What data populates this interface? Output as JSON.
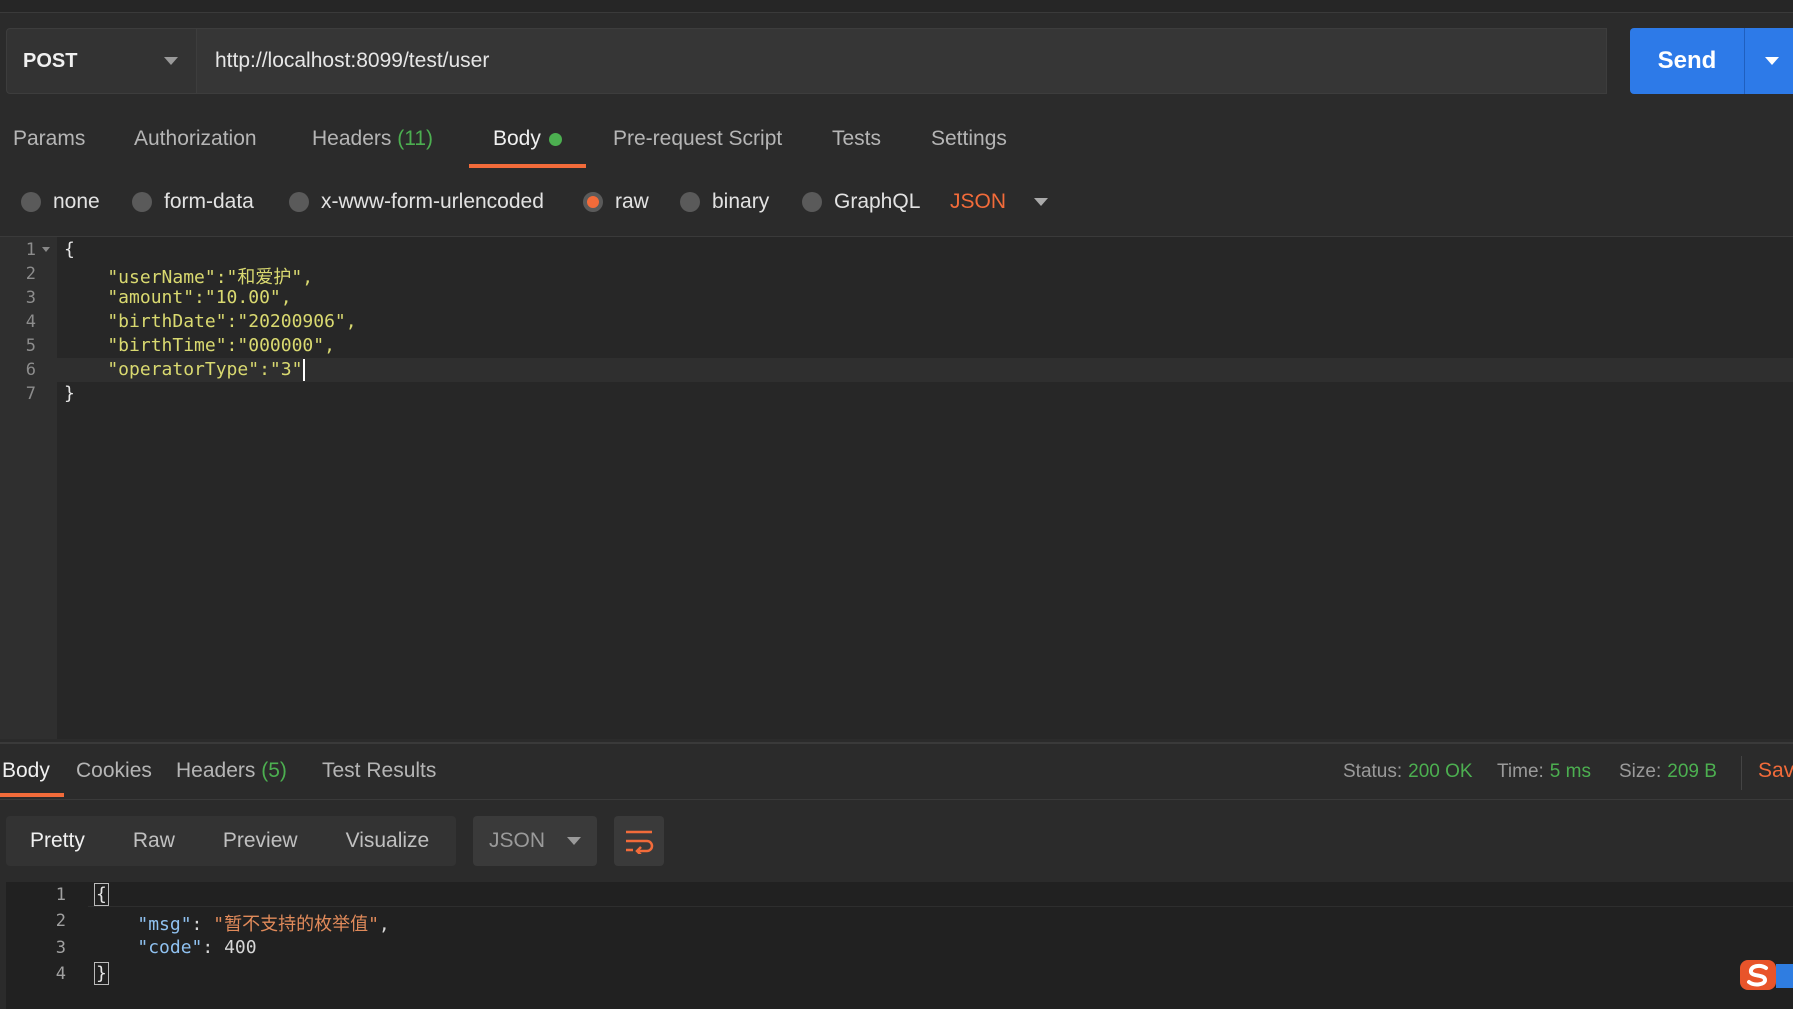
{
  "request": {
    "method": "POST",
    "url": "http://localhost:8099/test/user",
    "send_label": "Send"
  },
  "request_tabs": [
    {
      "label": "Params"
    },
    {
      "label": "Authorization"
    },
    {
      "label": "Headers",
      "count": "(11)"
    },
    {
      "label": "Body",
      "active": true,
      "indicator": "green-dot"
    },
    {
      "label": "Pre-request Script"
    },
    {
      "label": "Tests"
    },
    {
      "label": "Settings"
    }
  ],
  "body_types": [
    {
      "label": "none",
      "selected": false
    },
    {
      "label": "form-data",
      "selected": false
    },
    {
      "label": "x-www-form-urlencoded",
      "selected": false
    },
    {
      "label": "raw",
      "selected": true
    },
    {
      "label": "binary",
      "selected": false
    },
    {
      "label": "GraphQL",
      "selected": false
    }
  ],
  "body_language": "JSON",
  "request_body": {
    "line_numbers": [
      "1",
      "2",
      "3",
      "4",
      "5",
      "6",
      "7"
    ],
    "lines": [
      "{",
      "    \"userName\":\"和爱护\",",
      "    \"amount\":\"10.00\",",
      "    \"birthDate\":\"20200906\",",
      "    \"birthTime\":\"000000\",",
      "    \"operatorType\":\"3\"",
      "}"
    ]
  },
  "response_tabs": [
    {
      "label": "Body",
      "active": true
    },
    {
      "label": "Cookies"
    },
    {
      "label": "Headers",
      "count": "(5)"
    },
    {
      "label": "Test Results"
    }
  ],
  "response_status": {
    "status_label": "Status:",
    "status_value": "200 OK",
    "time_label": "Time:",
    "time_value": "5 ms",
    "size_label": "Size:",
    "size_value": "209 B",
    "save_label": "Sav"
  },
  "view_modes": [
    "Pretty",
    "Raw",
    "Preview",
    "Visualize"
  ],
  "response_format": "JSON",
  "response_body": {
    "line_numbers": [
      "1",
      "2",
      "3",
      "4"
    ],
    "open_brace": "{",
    "msg_key": "\"msg\"",
    "msg_value": "\"暂不支持的枚举值\"",
    "code_key": "\"code\"",
    "code_value": "400",
    "close_brace": "}"
  },
  "colors": {
    "accent": "#f26b3a",
    "send_button": "#2d7ae8",
    "success": "#4caf50"
  }
}
